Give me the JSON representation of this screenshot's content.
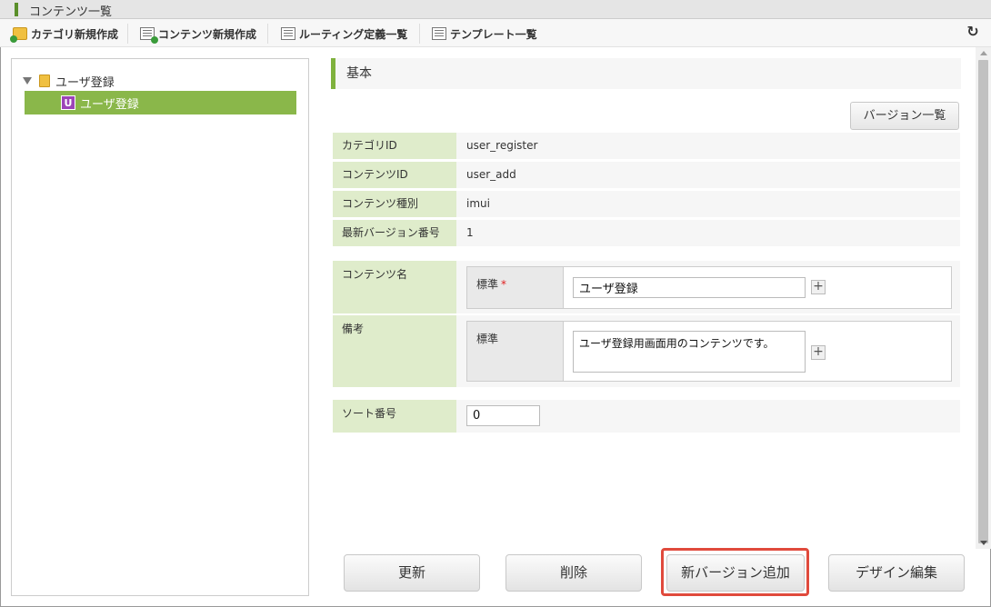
{
  "window": {
    "title": "コンテンツ一覧"
  },
  "toolbar": {
    "items": [
      {
        "label": "カテゴリ新規作成",
        "icon": "folder-add-icon"
      },
      {
        "label": "コンテンツ新規作成",
        "icon": "content-add-icon"
      },
      {
        "label": "ルーティング定義一覧",
        "icon": "list-icon"
      },
      {
        "label": "テンプレート一覧",
        "icon": "list-icon"
      }
    ],
    "refresh_icon": "↻"
  },
  "tree": {
    "root": {
      "label": "ユーザ登録"
    },
    "child": {
      "badge": "U",
      "label": "ユーザ登録"
    }
  },
  "detail": {
    "section_title": "基本",
    "versions_button": "バージョン一覧",
    "info": [
      {
        "label": "カテゴリID",
        "value": "user_register"
      },
      {
        "label": "コンテンツID",
        "value": "user_add"
      },
      {
        "label": "コンテンツ種別",
        "value": "imui"
      },
      {
        "label": "最新バージョン番号",
        "value": "1"
      }
    ],
    "content_name": {
      "label": "コンテンツ名",
      "locale_label": "標準",
      "required_mark": "*",
      "value": "ユーザ登録"
    },
    "remarks": {
      "label": "備考",
      "locale_label": "標準",
      "value": "ユーザ登録用画面用のコンテンツです。"
    },
    "sort_no": {
      "label": "ソート番号",
      "value": "0"
    }
  },
  "buttons": {
    "update": "更新",
    "delete": "削除",
    "new_version": "新バージョン追加",
    "design_edit": "デザイン編集"
  },
  "colors": {
    "accent_green": "#8ab74a",
    "label_bg": "#dfeccb",
    "highlight_red": "#e04a3c",
    "badge_purple": "#9c44b8"
  }
}
